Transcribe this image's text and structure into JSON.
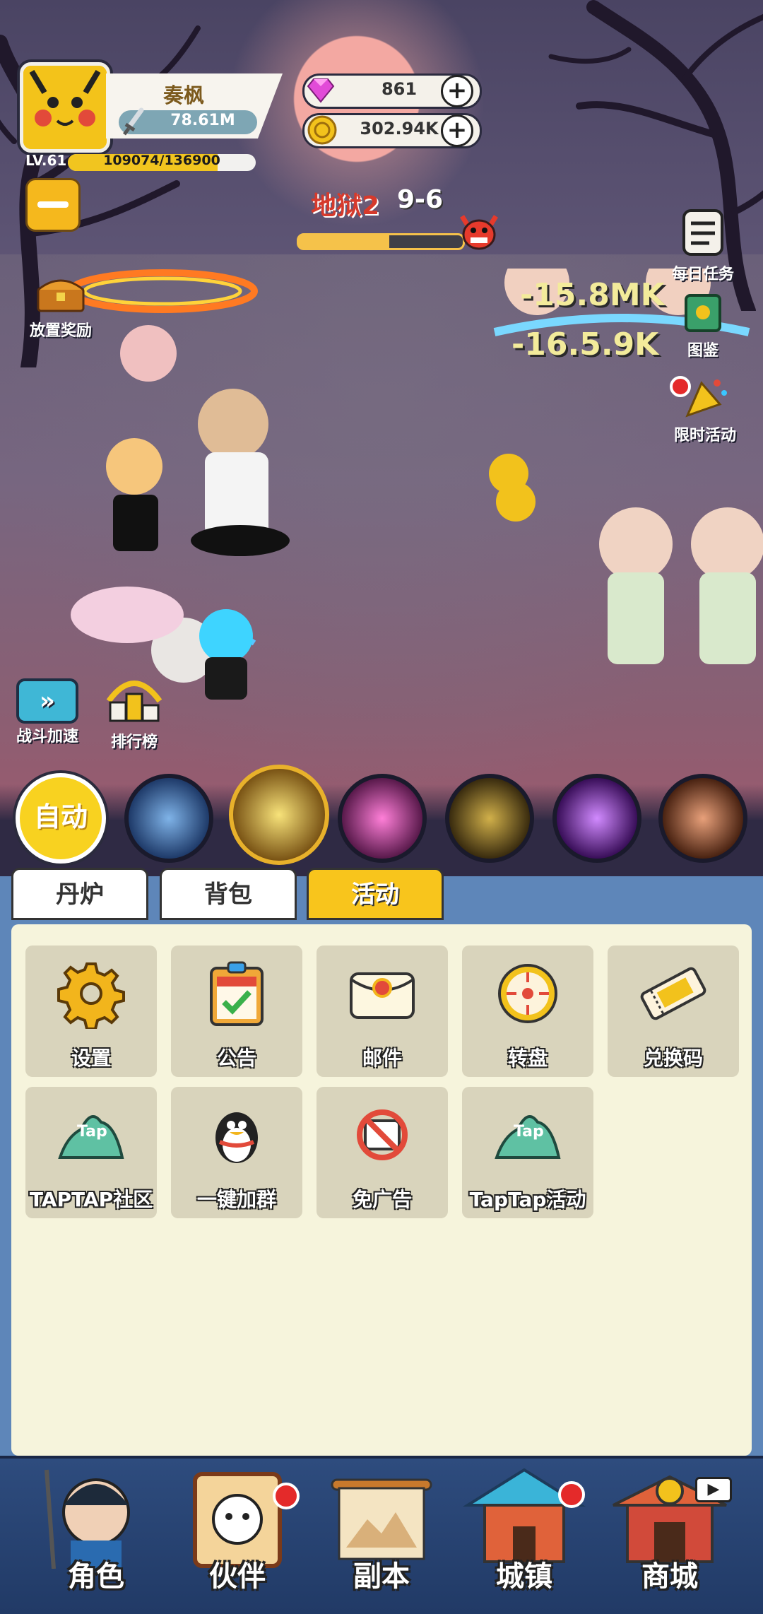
{
  "player": {
    "name": "奏枫",
    "power": "78.61M",
    "level": "LV.61",
    "exp_text": "109074/136900",
    "exp_fraction": 0.797
  },
  "currency": {
    "gems": "861",
    "gold": "302.94K"
  },
  "stage": {
    "name": "地狱2",
    "number": "9-6",
    "progress_fraction": 0.55
  },
  "side_buttons": {
    "idle_reward": "放置奖励",
    "daily_tasks": "每日任务",
    "codex": "图鉴",
    "limited_event": "限时活动",
    "battle_speed": "战斗加速",
    "leaderboard": "排行榜"
  },
  "damage_numbers": [
    "-15.8MK",
    "-16.5.9K"
  ],
  "skills": {
    "auto_label": "自动"
  },
  "tabs": [
    {
      "label": "丹炉",
      "active": false
    },
    {
      "label": "背包",
      "active": false
    },
    {
      "label": "活动",
      "active": true
    }
  ],
  "activity_tiles": [
    {
      "label": "设置",
      "icon": "gear-icon"
    },
    {
      "label": "公告",
      "icon": "notice-board-icon"
    },
    {
      "label": "邮件",
      "icon": "mail-icon"
    },
    {
      "label": "转盘",
      "icon": "wheel-icon"
    },
    {
      "label": "兑换码",
      "icon": "ticket-icon"
    },
    {
      "label": "TAPTAP社区",
      "icon": "taptap-icon"
    },
    {
      "label": "一键加群",
      "icon": "qq-penguin-icon"
    },
    {
      "label": "免广告",
      "icon": "no-ads-icon"
    },
    {
      "label": "TapTap活动",
      "icon": "taptap-icon"
    }
  ],
  "nav": [
    {
      "label": "角色"
    },
    {
      "label": "伙伴",
      "badge": true
    },
    {
      "label": "副本"
    },
    {
      "label": "城镇",
      "badge": true
    },
    {
      "label": "商城",
      "video_icon": true
    }
  ],
  "colors": {
    "accent_yellow": "#f8c51c",
    "panel_bg": "#f6f4dc",
    "nav_blue": "#2e4c7e",
    "red": "#d63a2c"
  }
}
